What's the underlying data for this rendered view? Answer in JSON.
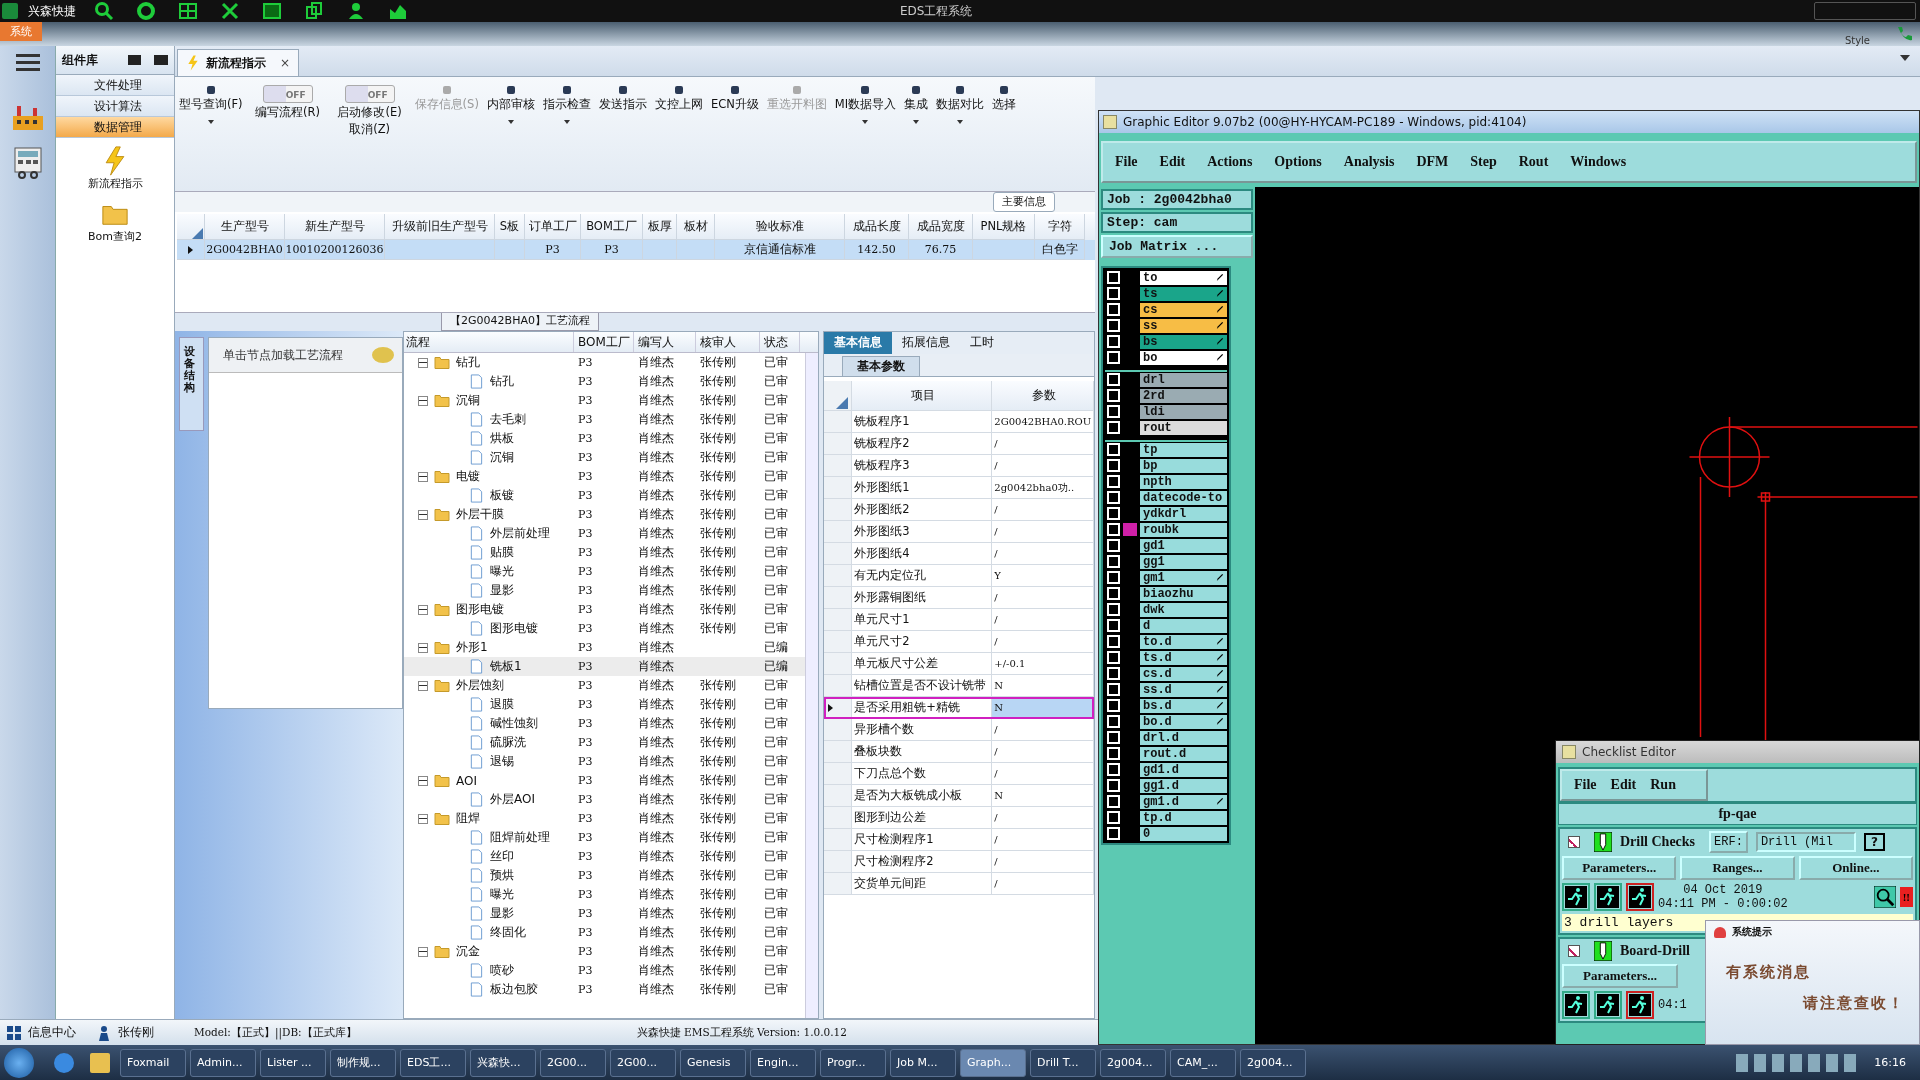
{
  "app": {
    "brand": "兴森快捷",
    "title": "EDS工程系统",
    "menu_tab": "系统",
    "style_label": "Style"
  },
  "nav": {
    "title": "组件库",
    "items": [
      {
        "label": "文件处理",
        "selected": false
      },
      {
        "label": "设计算法",
        "selected": false
      },
      {
        "label": "数据管理",
        "selected": true
      }
    ],
    "tiles": [
      {
        "label": "新流程指示",
        "kind": "bolt"
      },
      {
        "label": "Bom查询2",
        "kind": "folder"
      }
    ]
  },
  "doc_tab": {
    "label": "新流程指示",
    "close": "×"
  },
  "toolbar": [
    {
      "kind": "button",
      "label": "型号查询(F)",
      "dropdown": true,
      "disabled": false
    },
    {
      "kind": "toggle",
      "label": "编写流程(R)",
      "switch_text": "OFF",
      "on": false
    },
    {
      "kind": "toggle",
      "label": "启动修改(E)",
      "sub_label": "取消(Z)",
      "switch_text": "OFF",
      "on": false
    },
    {
      "kind": "button",
      "label": "保存信息(S)",
      "dropdown": false,
      "disabled": true
    },
    {
      "kind": "button",
      "label": "内部审核",
      "dropdown": true,
      "disabled": false
    },
    {
      "kind": "button",
      "label": "指示检查",
      "dropdown": true,
      "disabled": false
    },
    {
      "kind": "button",
      "label": "发送指示",
      "dropdown": false,
      "disabled": false
    },
    {
      "kind": "button",
      "label": "文控上网",
      "dropdown": false,
      "disabled": false
    },
    {
      "kind": "button",
      "label": "ECN升级",
      "dropdown": false,
      "disabled": false
    },
    {
      "kind": "button",
      "label": "重选开料图",
      "dropdown": false,
      "disabled": true
    },
    {
      "kind": "button",
      "label": "MI数据导入",
      "dropdown": true,
      "disabled": false
    },
    {
      "kind": "button",
      "label": "集成",
      "dropdown": true,
      "disabled": false
    },
    {
      "kind": "button",
      "label": "数据对比",
      "dropdown": true,
      "disabled": false
    },
    {
      "kind": "button",
      "label": "选择",
      "dropdown": false,
      "disabled": false
    }
  ],
  "main_info_button": "主要信息",
  "grid": {
    "columns": [
      "生产型号",
      "新生产型号",
      "升级前旧生产型号",
      "S板",
      "订单工厂",
      "BOM工厂",
      "板厚",
      "板材",
      "验收标准",
      "成品长度",
      "成品宽度",
      "PNL规格",
      "字符"
    ],
    "rows": [
      {
        "selected": true,
        "cells": [
          "2G0042BHA0",
          "10010200126036",
          "",
          "",
          "P3",
          "P3",
          "",
          "",
          "京信通信标准",
          "142.50",
          "76.75",
          "",
          "白色字"
        ]
      }
    ]
  },
  "process_title": "【2G0042BHA0】工艺流程",
  "side_tab": "设备结构",
  "hint": "单击节点加载工艺流程",
  "tree": {
    "columns": [
      "流程",
      "BOM工厂",
      "编写人",
      "核审人",
      "状态"
    ],
    "nodes": [
      {
        "name": "钻孔",
        "factory": "P3",
        "writer": "肖维杰",
        "reviewer": "张传刚",
        "status": "已审",
        "selected": false,
        "expanded": true,
        "children": [
          {
            "name": "钻孔",
            "factory": "P3",
            "writer": "肖维杰",
            "reviewer": "张传刚",
            "status": "已审",
            "selected": false
          }
        ]
      },
      {
        "name": "沉铜",
        "factory": "P3",
        "writer": "肖维杰",
        "reviewer": "张传刚",
        "status": "已审",
        "selected": false,
        "expanded": true,
        "children": [
          {
            "name": "去毛刺",
            "factory": "P3",
            "writer": "肖维杰",
            "reviewer": "张传刚",
            "status": "已审",
            "selected": false
          },
          {
            "name": "烘板",
            "factory": "P3",
            "writer": "肖维杰",
            "reviewer": "张传刚",
            "status": "已审",
            "selected": false
          },
          {
            "name": "沉铜",
            "factory": "P3",
            "writer": "肖维杰",
            "reviewer": "张传刚",
            "status": "已审",
            "selected": false
          }
        ]
      },
      {
        "name": "电镀",
        "factory": "P3",
        "writer": "肖维杰",
        "reviewer": "张传刚",
        "status": "已审",
        "selected": false,
        "expanded": true,
        "children": [
          {
            "name": "板镀",
            "factory": "P3",
            "writer": "肖维杰",
            "reviewer": "张传刚",
            "status": "已审",
            "selected": false
          }
        ]
      },
      {
        "name": "外层干膜",
        "factory": "P3",
        "writer": "肖维杰",
        "reviewer": "张传刚",
        "status": "已审",
        "selected": false,
        "expanded": true,
        "children": [
          {
            "name": "外层前处理",
            "factory": "P3",
            "writer": "肖维杰",
            "reviewer": "张传刚",
            "status": "已审",
            "selected": false
          },
          {
            "name": "贴膜",
            "factory": "P3",
            "writer": "肖维杰",
            "reviewer": "张传刚",
            "status": "已审",
            "selected": false
          },
          {
            "name": "曝光",
            "factory": "P3",
            "writer": "肖维杰",
            "reviewer": "张传刚",
            "status": "已审",
            "selected": false
          },
          {
            "name": "显影",
            "factory": "P3",
            "writer": "肖维杰",
            "reviewer": "张传刚",
            "status": "已审",
            "selected": false
          }
        ]
      },
      {
        "name": "图形电镀",
        "factory": "P3",
        "writer": "肖维杰",
        "reviewer": "张传刚",
        "status": "已审",
        "selected": false,
        "expanded": true,
        "children": [
          {
            "name": "图形电镀",
            "factory": "P3",
            "writer": "肖维杰",
            "reviewer": "张传刚",
            "status": "已审",
            "selected": false
          }
        ]
      },
      {
        "name": "外形1",
        "factory": "P3",
        "writer": "肖维杰",
        "status": "已编",
        "selected": false,
        "expanded": true,
        "children": [
          {
            "name": "铣板1",
            "factory": "P3",
            "writer": "肖维杰",
            "status": "已编",
            "selected": true
          }
        ]
      },
      {
        "name": "外层蚀刻",
        "factory": "P3",
        "writer": "肖维杰",
        "reviewer": "张传刚",
        "status": "已审",
        "selected": false,
        "expanded": true,
        "children": [
          {
            "name": "退膜",
            "factory": "P3",
            "writer": "肖维杰",
            "reviewer": "张传刚",
            "status": "已审",
            "selected": false
          },
          {
            "name": "碱性蚀刻",
            "factory": "P3",
            "writer": "肖维杰",
            "reviewer": "张传刚",
            "status": "已审",
            "selected": false
          },
          {
            "name": "硫脲洗",
            "factory": "P3",
            "writer": "肖维杰",
            "reviewer": "张传刚",
            "status": "已审",
            "selected": false
          },
          {
            "name": "退锡",
            "factory": "P3",
            "writer": "肖维杰",
            "reviewer": "张传刚",
            "status": "已审",
            "selected": false
          }
        ]
      },
      {
        "name": "AOI",
        "factory": "P3",
        "writer": "肖维杰",
        "reviewer": "张传刚",
        "status": "已审",
        "selected": false,
        "expanded": true,
        "children": [
          {
            "name": "外层AOI",
            "factory": "P3",
            "writer": "肖维杰",
            "reviewer": "张传刚",
            "status": "已审",
            "selected": false
          }
        ]
      },
      {
        "name": "阻焊",
        "factory": "P3",
        "writer": "肖维杰",
        "reviewer": "张传刚",
        "status": "已审",
        "selected": false,
        "expanded": true,
        "children": [
          {
            "name": "阻焊前处理",
            "factory": "P3",
            "writer": "肖维杰",
            "reviewer": "张传刚",
            "status": "已审",
            "selected": false
          },
          {
            "name": "丝印",
            "factory": "P3",
            "writer": "肖维杰",
            "reviewer": "张传刚",
            "status": "已审",
            "selected": false
          },
          {
            "name": "预烘",
            "factory": "P3",
            "writer": "肖维杰",
            "reviewer": "张传刚",
            "status": "已审",
            "selected": false
          },
          {
            "name": "曝光",
            "factory": "P3",
            "writer": "肖维杰",
            "reviewer": "张传刚",
            "status": "已审",
            "selected": false
          },
          {
            "name": "显影",
            "factory": "P3",
            "writer": "肖维杰",
            "reviewer": "张传刚",
            "status": "已审",
            "selected": false
          },
          {
            "name": "终固化",
            "factory": "P3",
            "writer": "肖维杰",
            "reviewer": "张传刚",
            "status": "已审",
            "selected": false
          }
        ]
      },
      {
        "name": "沉金",
        "factory": "P3",
        "writer": "肖维杰",
        "reviewer": "张传刚",
        "status": "已审",
        "selected": false,
        "expanded": true,
        "children": [
          {
            "name": "喷砂",
            "factory": "P3",
            "writer": "肖维杰",
            "reviewer": "张传刚",
            "status": "已审",
            "selected": false
          },
          {
            "name": "板边包胶",
            "factory": "P3",
            "writer": "肖维杰",
            "reviewer": "张传刚",
            "status": "已审",
            "selected": false
          }
        ]
      }
    ]
  },
  "props": {
    "tabs": [
      {
        "label": "基本信息",
        "selected": true
      },
      {
        "label": "拓展信息",
        "selected": false
      },
      {
        "label": "工时",
        "selected": false
      }
    ],
    "subtab": "基本参数",
    "columns": [
      "项目",
      "参数"
    ],
    "rows": [
      {
        "item": "铣板程序1",
        "value": "2G0042BHA0.ROU",
        "selected": false
      },
      {
        "item": "铣板程序2",
        "value": "/",
        "selected": false
      },
      {
        "item": "铣板程序3",
        "value": "/",
        "selected": false
      },
      {
        "item": "外形图纸1",
        "value": "2g0042bha0功..",
        "selected": false
      },
      {
        "item": "外形图纸2",
        "value": "/",
        "selected": false
      },
      {
        "item": "外形图纸3",
        "value": "/",
        "selected": false
      },
      {
        "item": "外形图纸4",
        "value": "/",
        "selected": false
      },
      {
        "item": "有无内定位孔",
        "value": "Y",
        "selected": false
      },
      {
        "item": "外形露铜图纸",
        "value": "/",
        "selected": false
      },
      {
        "item": "单元尺寸1",
        "value": "/",
        "selected": false
      },
      {
        "item": "单元尺寸2",
        "value": "/",
        "selected": false
      },
      {
        "item": "单元板尺寸公差",
        "value": "+/-0.1",
        "selected": false
      },
      {
        "item": "钻槽位置是否不设计铣带",
        "value": "N",
        "selected": false
      },
      {
        "item": "是否采用粗铣+精铣",
        "value": "N",
        "selected": true
      },
      {
        "item": "异形槽个数",
        "value": "/",
        "selected": false
      },
      {
        "item": "叠板块数",
        "value": "/",
        "selected": false
      },
      {
        "item": "下刀点总个数",
        "value": "/",
        "selected": false
      },
      {
        "item": "是否为大板铣成小板",
        "value": "N",
        "selected": false
      },
      {
        "item": "图形到边公差",
        "value": "/",
        "selected": false
      },
      {
        "item": "尺寸检测程序1",
        "value": "/",
        "selected": false
      },
      {
        "item": "尺寸检测程序2",
        "value": "/",
        "selected": false
      },
      {
        "item": "交货单元间距",
        "value": "/",
        "selected": false
      }
    ]
  },
  "status_bar": {
    "info_center": "信息中心",
    "user": "张传刚",
    "env": "Model:【正式】||DB:【正式库】",
    "product": "兴森快捷 EMS工程系统 Version: 1.0.0.12"
  },
  "editor": {
    "title": "Graphic Editor 9.07b2 (00@HY-HYCAM-PC189 - Windows, pid:4104)",
    "menu": [
      "File",
      "Edit",
      "Actions",
      "Options",
      "Analysis",
      "DFM",
      "Step",
      "Rout",
      "Windows"
    ],
    "job": "Job : 2g0042bha0",
    "step": "Step: cam",
    "matrix_button": "Job Matrix ...",
    "layer_groups": [
      {
        "layers": [
          {
            "name": "to",
            "color": "#ffffff",
            "checked": false,
            "affected": true,
            "work": false
          },
          {
            "name": "ts",
            "color": "#1aa58a",
            "checked": false,
            "affected": true,
            "work": false
          },
          {
            "name": "cs",
            "color": "#f7bd45",
            "checked": false,
            "affected": true,
            "work": false
          },
          {
            "name": "ss",
            "color": "#f7bd45",
            "checked": false,
            "affected": true,
            "work": false
          },
          {
            "name": "bs",
            "color": "#1aa58a",
            "checked": false,
            "affected": true,
            "work": false
          },
          {
            "name": "bo",
            "color": "#ffffff",
            "checked": false,
            "affected": true,
            "work": false
          }
        ]
      },
      {
        "layers": [
          {
            "name": "drl",
            "color": "#9aabb2",
            "checked": false,
            "affected": false,
            "work": false
          },
          {
            "name": "2rd",
            "color": "#9aabb2",
            "checked": false,
            "affected": false,
            "work": false
          },
          {
            "name": "ldi",
            "color": "#9aabb2",
            "checked": false,
            "affected": false,
            "work": false
          },
          {
            "name": "rout",
            "color": "#dcdcdc",
            "checked": false,
            "affected": false,
            "work": false
          }
        ]
      },
      {
        "layers": [
          {
            "name": "tp",
            "color": "#98dcdc",
            "checked": false,
            "affected": false,
            "work": false
          },
          {
            "name": "bp",
            "color": "#98dcdc",
            "checked": false,
            "affected": false,
            "work": false
          },
          {
            "name": "npth",
            "color": "#98dcdc",
            "checked": false,
            "affected": false,
            "work": false
          },
          {
            "name": "datecode-to",
            "color": "#98dcdc",
            "checked": false,
            "affected": false,
            "work": false
          },
          {
            "name": "ydkdrl",
            "color": "#98dcdc",
            "checked": false,
            "affected": false,
            "work": false
          },
          {
            "name": "roubk",
            "color": "#98dcdc",
            "checked": false,
            "affected": false,
            "work": true
          },
          {
            "name": "gd1",
            "color": "#98dcdc",
            "checked": false,
            "affected": false,
            "work": false
          },
          {
            "name": "gg1",
            "color": "#98dcdc",
            "checked": false,
            "affected": false,
            "work": false
          },
          {
            "name": "gm1",
            "color": "#98dcdc",
            "checked": false,
            "affected": true,
            "work": false
          },
          {
            "name": "biaozhu",
            "color": "#98dcdc",
            "checked": false,
            "affected": false,
            "work": false
          },
          {
            "name": "dwk",
            "color": "#98dcdc",
            "checked": false,
            "affected": false,
            "work": false
          },
          {
            "name": "d",
            "color": "#98dcdc",
            "checked": false,
            "affected": false,
            "work": false
          },
          {
            "name": "to.d",
            "color": "#98dcdc",
            "checked": false,
            "affected": true,
            "work": false
          },
          {
            "name": "ts.d",
            "color": "#98dcdc",
            "checked": false,
            "affected": true,
            "work": false
          },
          {
            "name": "cs.d",
            "color": "#98dcdc",
            "checked": false,
            "affected": true,
            "work": false
          },
          {
            "name": "ss.d",
            "color": "#98dcdc",
            "checked": false,
            "affected": true,
            "work": false
          },
          {
            "name": "bs.d",
            "color": "#98dcdc",
            "checked": false,
            "affected": true,
            "work": false
          },
          {
            "name": "bo.d",
            "color": "#98dcdc",
            "checked": false,
            "affected": true,
            "work": false
          },
          {
            "name": "drl.d",
            "color": "#98dcdc",
            "checked": false,
            "affected": false,
            "work": false
          },
          {
            "name": "rout.d",
            "color": "#98dcdc",
            "checked": false,
            "affected": false,
            "work": false
          },
          {
            "name": "gd1.d",
            "color": "#98dcdc",
            "checked": false,
            "affected": false,
            "work": false
          },
          {
            "name": "gg1.d",
            "color": "#98dcdc",
            "checked": false,
            "affected": false,
            "work": false
          },
          {
            "name": "gm1.d",
            "color": "#98dcdc",
            "checked": false,
            "affected": true,
            "work": false
          },
          {
            "name": "tp.d",
            "color": "#98dcdc",
            "checked": false,
            "affected": false,
            "work": false
          },
          {
            "name": "0",
            "color": "#98dcdc",
            "checked": false,
            "affected": false,
            "work": false
          }
        ]
      }
    ]
  },
  "checklist": {
    "title": "Checklist Editor",
    "menu": [
      "File",
      "Edit",
      "Run"
    ],
    "name": "fp-qae",
    "checks": [
      {
        "name": "Drill Checks",
        "checked": true,
        "erf_label": "ERF:",
        "erf_value": "Drill (Mil",
        "help": "?",
        "buttons": [
          "Parameters...",
          "Ranges...",
          "Online..."
        ],
        "date": "04 Oct 2019",
        "time": "04:11 PM - 0:00:02",
        "alert": "!!",
        "message": "3 drill layers"
      },
      {
        "name": "Board-Drill",
        "checked": true,
        "buttons": [
          "Parameters..."
        ],
        "time": "04:1"
      }
    ]
  },
  "popup": {
    "title": "系统提示",
    "line1": "有系统消息",
    "line2": "请注意查收！"
  },
  "taskbar": {
    "items": [
      {
        "label": "Foxmail",
        "active": false
      },
      {
        "label": "Admin...",
        "active": false
      },
      {
        "label": "Lister ...",
        "active": false
      },
      {
        "label": "制作规...",
        "active": false
      },
      {
        "label": "EDS工...",
        "active": false
      },
      {
        "label": "兴森快...",
        "active": false
      },
      {
        "label": "2G00...",
        "active": false
      },
      {
        "label": "2G00...",
        "active": false
      },
      {
        "label": "Genesis",
        "active": false
      },
      {
        "label": "Engin...",
        "active": false
      },
      {
        "label": "Progr...",
        "active": false
      },
      {
        "label": "Job M...",
        "active": false
      },
      {
        "label": "Graph...",
        "active": true
      },
      {
        "label": "Drill T...",
        "active": false
      },
      {
        "label": "2g004...",
        "active": false
      },
      {
        "label": "CAM_...",
        "active": false
      },
      {
        "label": "2g004...",
        "active": false
      }
    ],
    "clock": "16:16"
  }
}
